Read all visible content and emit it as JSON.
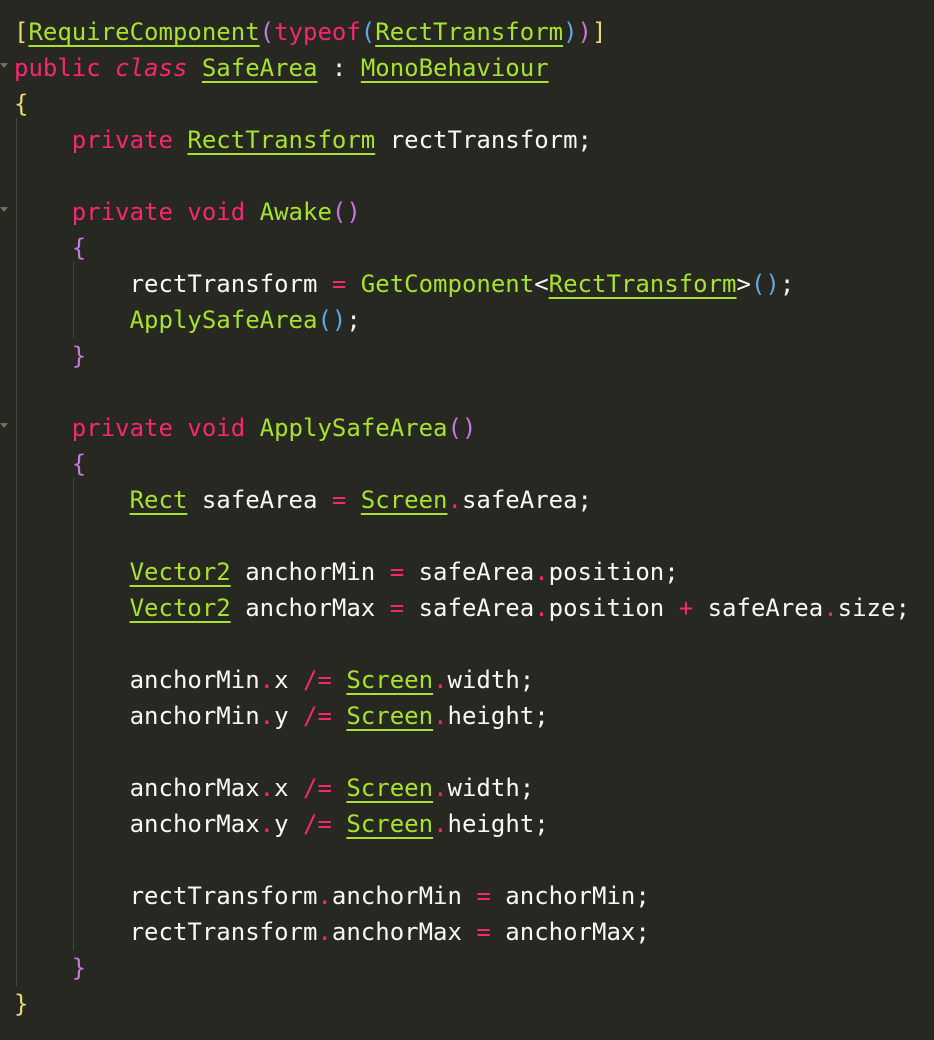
{
  "editor": {
    "theme_colors": {
      "background": "#272822",
      "text": "#f8f8f2",
      "keyword": "#f92672",
      "type": "#a6e22e",
      "bracket_level_1": "#e6db74",
      "bracket_level_2": "#c678dd",
      "bracket_level_3": "#5fa8e8"
    },
    "lines": [
      [
        [
          "[",
          "b1"
        ],
        [
          "RequireComponent",
          "type"
        ],
        [
          "(",
          "b2"
        ],
        [
          "typeof",
          "kw"
        ],
        [
          "(",
          "b3"
        ],
        [
          "RectTransform",
          "type"
        ],
        [
          ")",
          "b3"
        ],
        [
          ")",
          "b2"
        ],
        [
          "]",
          "b1"
        ]
      ],
      [
        [
          "public",
          "kw"
        ],
        [
          " ",
          "def"
        ],
        [
          "class",
          "italic"
        ],
        [
          " ",
          "def"
        ],
        [
          "SafeArea",
          "type"
        ],
        [
          " : ",
          "def"
        ],
        [
          "MonoBehaviour",
          "type"
        ]
      ],
      [
        [
          "{",
          "b1"
        ]
      ],
      [
        [
          "    ",
          "def"
        ],
        [
          "private",
          "kw"
        ],
        [
          " ",
          "def"
        ],
        [
          "RectTransform",
          "type"
        ],
        [
          " rectTransform;",
          "def"
        ]
      ],
      [],
      [
        [
          "    ",
          "def"
        ],
        [
          "private",
          "kw"
        ],
        [
          " ",
          "def"
        ],
        [
          "void",
          "kw"
        ],
        [
          " ",
          "def"
        ],
        [
          "Awake",
          "fn"
        ],
        [
          "()",
          "b2"
        ]
      ],
      [
        [
          "    ",
          "def"
        ],
        [
          "{",
          "b2"
        ]
      ],
      [
        [
          "        ",
          "def"
        ],
        [
          "rectTransform ",
          "def"
        ],
        [
          "=",
          "op"
        ],
        [
          " ",
          "def"
        ],
        [
          "GetComponent",
          "fn"
        ],
        [
          "<",
          "def"
        ],
        [
          "RectTransform",
          "type"
        ],
        [
          ">",
          "def"
        ],
        [
          "()",
          "b3"
        ],
        [
          ";",
          "def"
        ]
      ],
      [
        [
          "        ",
          "def"
        ],
        [
          "ApplySafeArea",
          "fn"
        ],
        [
          "()",
          "b3"
        ],
        [
          ";",
          "def"
        ]
      ],
      [
        [
          "    ",
          "def"
        ],
        [
          "}",
          "b2"
        ]
      ],
      [],
      [
        [
          "    ",
          "def"
        ],
        [
          "private",
          "kw"
        ],
        [
          " ",
          "def"
        ],
        [
          "void",
          "kw"
        ],
        [
          " ",
          "def"
        ],
        [
          "ApplySafeArea",
          "fn"
        ],
        [
          "()",
          "b2"
        ]
      ],
      [
        [
          "    ",
          "def"
        ],
        [
          "{",
          "b2"
        ]
      ],
      [
        [
          "        ",
          "def"
        ],
        [
          "Rect",
          "type"
        ],
        [
          " safeArea ",
          "def"
        ],
        [
          "=",
          "op"
        ],
        [
          " ",
          "def"
        ],
        [
          "Screen",
          "type"
        ],
        [
          ".",
          "op"
        ],
        [
          "safeArea;",
          "def"
        ]
      ],
      [],
      [
        [
          "        ",
          "def"
        ],
        [
          "Vector2",
          "type"
        ],
        [
          " anchorMin ",
          "def"
        ],
        [
          "=",
          "op"
        ],
        [
          " safeArea",
          "def"
        ],
        [
          ".",
          "op"
        ],
        [
          "position;",
          "def"
        ]
      ],
      [
        [
          "        ",
          "def"
        ],
        [
          "Vector2",
          "type"
        ],
        [
          " anchorMax ",
          "def"
        ],
        [
          "=",
          "op"
        ],
        [
          " safeArea",
          "def"
        ],
        [
          ".",
          "op"
        ],
        [
          "position ",
          "def"
        ],
        [
          "+",
          "op"
        ],
        [
          " safeArea",
          "def"
        ],
        [
          ".",
          "op"
        ],
        [
          "size;",
          "def"
        ]
      ],
      [],
      [
        [
          "        ",
          "def"
        ],
        [
          "anchorMin",
          "def"
        ],
        [
          ".",
          "op"
        ],
        [
          "x ",
          "def"
        ],
        [
          "/=",
          "op"
        ],
        [
          " ",
          "def"
        ],
        [
          "Screen",
          "type"
        ],
        [
          ".",
          "op"
        ],
        [
          "width;",
          "def"
        ]
      ],
      [
        [
          "        ",
          "def"
        ],
        [
          "anchorMin",
          "def"
        ],
        [
          ".",
          "op"
        ],
        [
          "y ",
          "def"
        ],
        [
          "/=",
          "op"
        ],
        [
          " ",
          "def"
        ],
        [
          "Screen",
          "type"
        ],
        [
          ".",
          "op"
        ],
        [
          "height;",
          "def"
        ]
      ],
      [],
      [
        [
          "        ",
          "def"
        ],
        [
          "anchorMax",
          "def"
        ],
        [
          ".",
          "op"
        ],
        [
          "x ",
          "def"
        ],
        [
          "/=",
          "op"
        ],
        [
          " ",
          "def"
        ],
        [
          "Screen",
          "type"
        ],
        [
          ".",
          "op"
        ],
        [
          "width;",
          "def"
        ]
      ],
      [
        [
          "        ",
          "def"
        ],
        [
          "anchorMax",
          "def"
        ],
        [
          ".",
          "op"
        ],
        [
          "y ",
          "def"
        ],
        [
          "/=",
          "op"
        ],
        [
          " ",
          "def"
        ],
        [
          "Screen",
          "type"
        ],
        [
          ".",
          "op"
        ],
        [
          "height;",
          "def"
        ]
      ],
      [],
      [
        [
          "        ",
          "def"
        ],
        [
          "rectTransform",
          "def"
        ],
        [
          ".",
          "op"
        ],
        [
          "anchorMin ",
          "def"
        ],
        [
          "=",
          "op"
        ],
        [
          " anchorMin;",
          "def"
        ]
      ],
      [
        [
          "        ",
          "def"
        ],
        [
          "rectTransform",
          "def"
        ],
        [
          ".",
          "op"
        ],
        [
          "anchorMax ",
          "def"
        ],
        [
          "=",
          "op"
        ],
        [
          " anchorMax;",
          "def"
        ]
      ],
      [
        [
          "    ",
          "def"
        ],
        [
          "}",
          "b2"
        ]
      ],
      [
        [
          "}",
          "b1"
        ]
      ]
    ]
  }
}
